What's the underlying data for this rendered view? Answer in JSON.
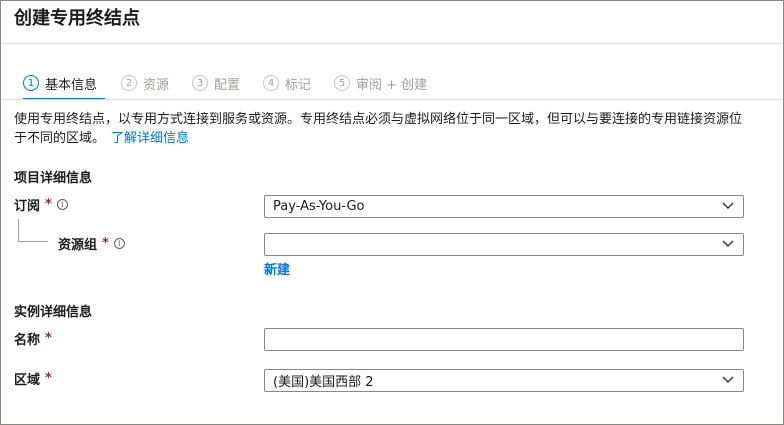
{
  "page": {
    "title": "创建专用终结点"
  },
  "tabs": [
    {
      "num": "1",
      "label": "基本信息"
    },
    {
      "num": "2",
      "label": "资源"
    },
    {
      "num": "3",
      "label": "配置"
    },
    {
      "num": "4",
      "label": "标记"
    },
    {
      "num": "5",
      "label": "审阅 + 创建"
    }
  ],
  "description": {
    "text": "使用专用终结点，以专用方式连接到服务或资源。专用终结点必须与虚拟网络位于同一区域，但可以与要连接的专用链接资源位于不同的区域。",
    "link": "了解详细信息"
  },
  "project_details": {
    "heading": "项目详细信息",
    "subscription_label": "订阅",
    "subscription_value": "Pay-As-You-Go",
    "resource_group_label": "资源组",
    "resource_group_value": "",
    "new_link": "新建"
  },
  "instance_details": {
    "heading": "实例详细信息",
    "name_label": "名称",
    "name_value": "",
    "region_label": "区域",
    "region_value": "(美国)美国西部 2"
  },
  "common": {
    "required_mark": "*",
    "info_glyph": "i"
  },
  "colors": {
    "accent": "#0078d4",
    "required": "#a4262c",
    "border": "#8a8886"
  }
}
